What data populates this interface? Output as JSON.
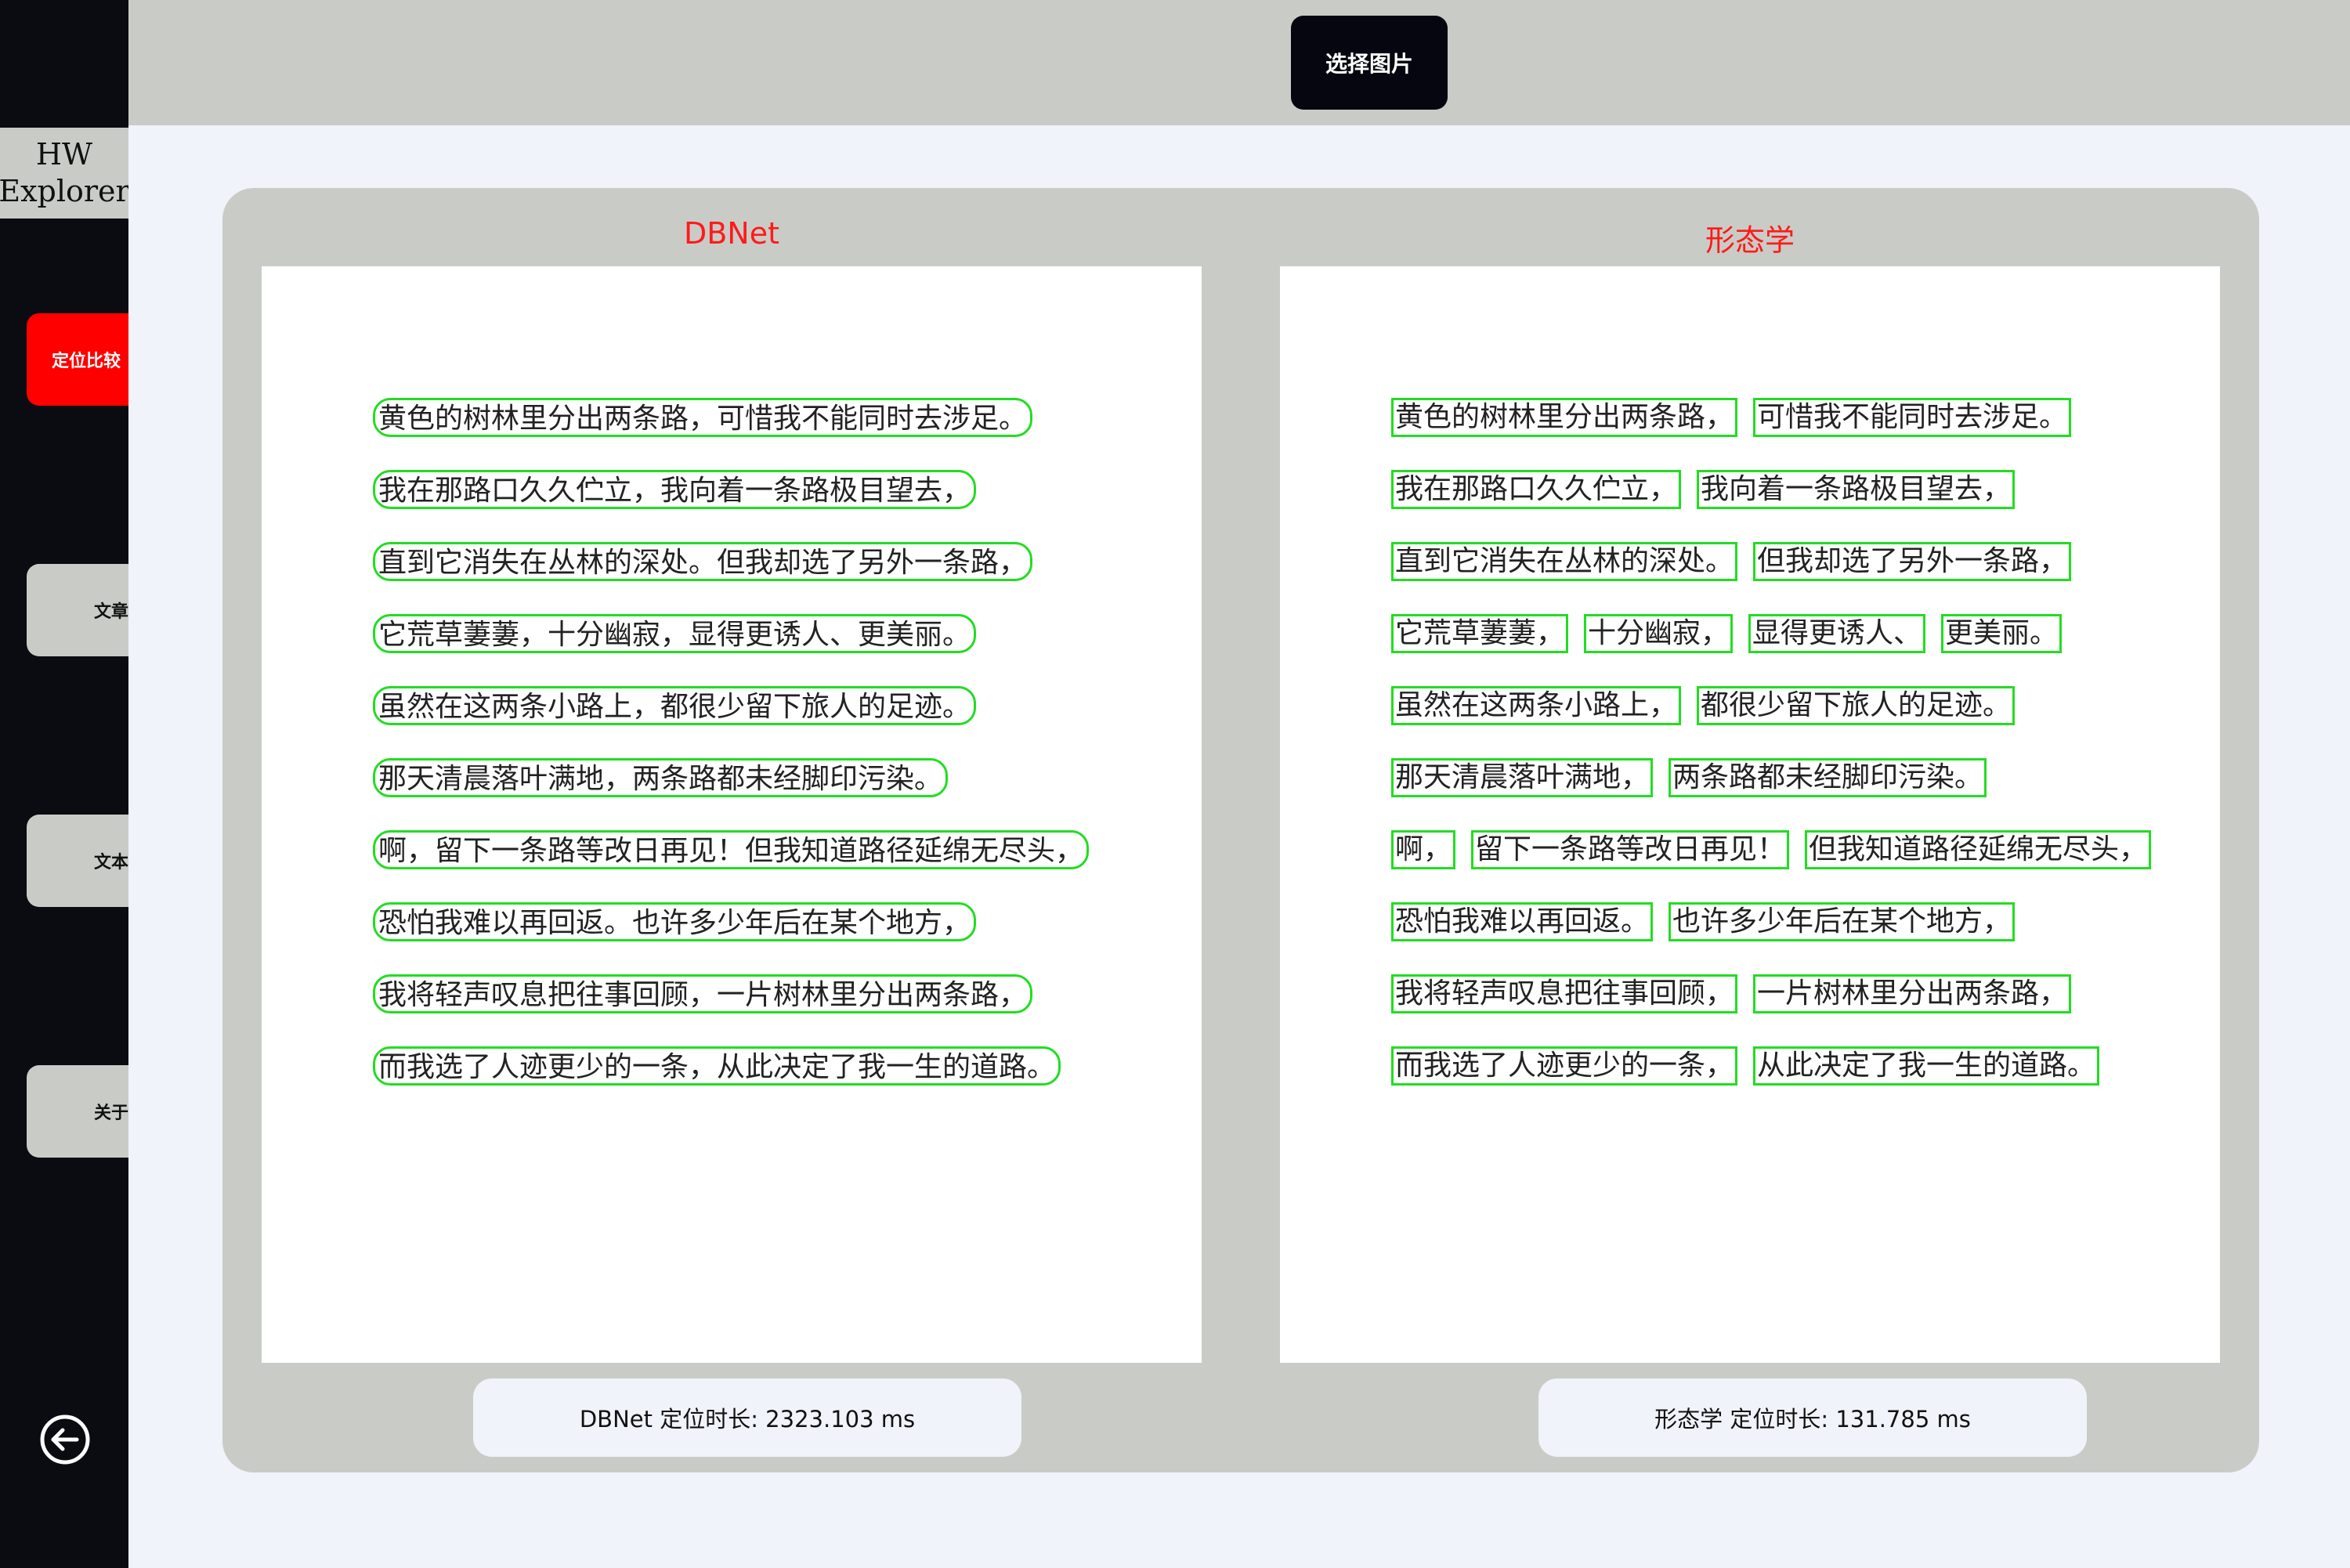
{
  "sidebar": {
    "brand": [
      "HW",
      "Explorer"
    ],
    "nav": [
      {
        "label": "定位比较",
        "active": true
      },
      {
        "label": "文章",
        "active": false
      },
      {
        "label": "文本行",
        "active": false
      },
      {
        "label": "关于",
        "active": false
      }
    ],
    "logout_icon": "logout-icon"
  },
  "toolbar": {
    "select_image_label": "选择图片"
  },
  "comparison": {
    "left": {
      "title": "DBNet",
      "timing": "DBNet 定位时长: 2323.103 ms",
      "lines": [
        "黄色的树林里分出两条路，可惜我不能同时去涉足。",
        "我在那路口久久伫立，我向着一条路极目望去，",
        "直到它消失在丛林的深处。但我却选了另外一条路，",
        "它荒草萋萋，十分幽寂，显得更诱人、更美丽。",
        "虽然在这两条小路上，都很少留下旅人的足迹。",
        "那天清晨落叶满地，两条路都未经脚印污染。",
        "啊，留下一条路等改日再见！但我知道路径延绵无尽头，",
        "恐怕我难以再回返。也许多少年后在某个地方，",
        "我将轻声叹息把往事回顾，一片树林里分出两条路，",
        "而我选了人迹更少的一条，从此决定了我一生的道路。"
      ]
    },
    "right": {
      "title": "形态学",
      "timing": "形态学 定位时长: 131.785 ms",
      "lines": [
        [
          "黄色的树林里分出两条路，",
          "可惜我不能同时去涉足。"
        ],
        [
          "我在那路口久久伫立，",
          "我向着一条路极目望去，"
        ],
        [
          "直到它消失在丛林的深处。",
          "但我却选了另外一条路，"
        ],
        [
          "它荒草萋萋，",
          "十分幽寂，",
          "显得更诱人、",
          "更美丽。"
        ],
        [
          "虽然在这两条小路上，",
          "都很少留下旅人的足迹。"
        ],
        [
          "那天清晨落叶满地，",
          "两条路都未经脚印污染。"
        ],
        [
          "啊，",
          "留下一条路等改日再见！",
          "但我知道路径延绵无尽头，"
        ],
        [
          "恐怕我难以再回返。",
          "也许多少年后在某个地方，"
        ],
        [
          "我将轻声叹息把往事回顾，",
          "一片树林里分出两条路，"
        ],
        [
          "而我选了人迹更少的一条，",
          "从此决定了我一生的道路。"
        ]
      ]
    }
  },
  "colors": {
    "highlight": "#22dd22",
    "title": "#ff1a1a",
    "active_nav": "#ff0000"
  }
}
